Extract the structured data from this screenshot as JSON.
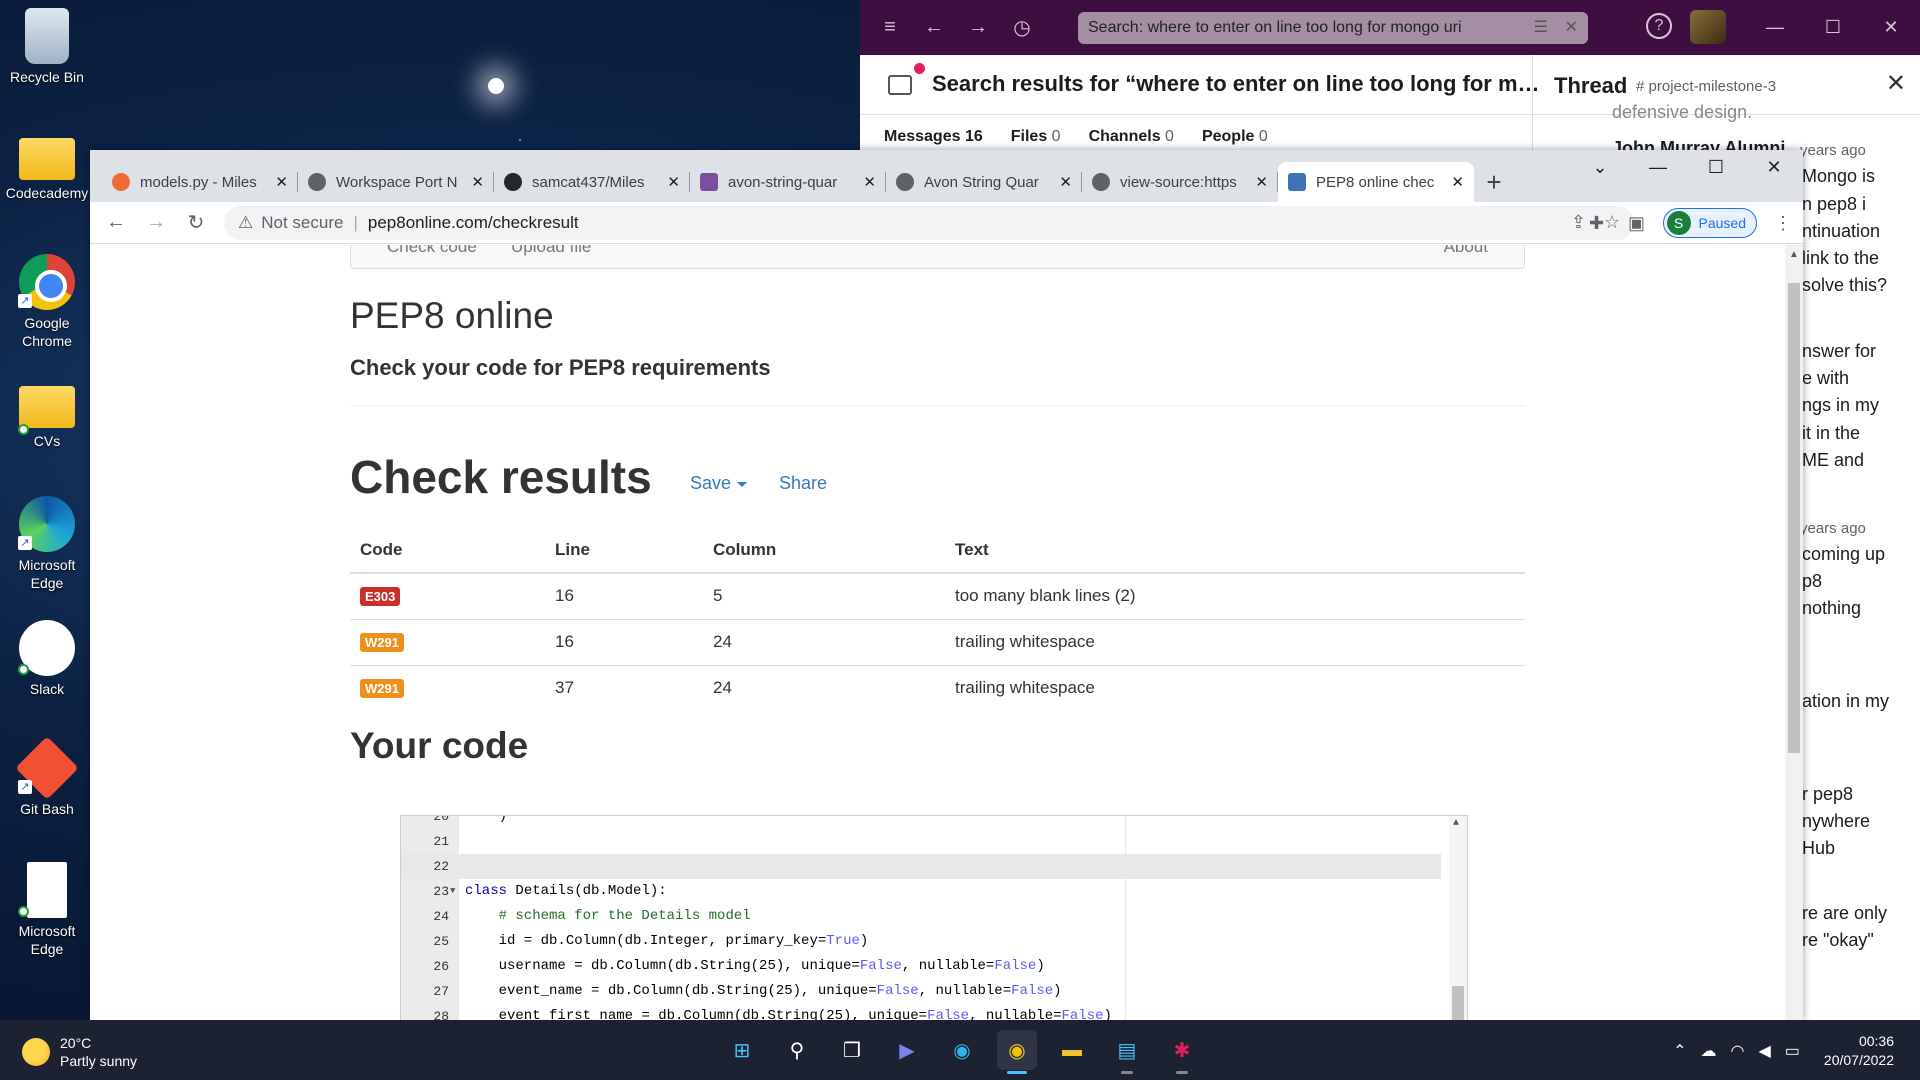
{
  "desktop": {
    "icons": [
      {
        "label": "Recycle Bin"
      },
      {
        "label": "Codecademy"
      },
      {
        "label": "Google Chrome"
      },
      {
        "label": "CVs"
      },
      {
        "label": "Microsoft Edge"
      },
      {
        "label": "Slack"
      },
      {
        "label": "Git Bash"
      },
      {
        "label": "Microsoft Edge"
      }
    ]
  },
  "slack": {
    "search_text": "Search: where to enter on line too long for mongo uri",
    "help_glyph": "?",
    "results_title": "Search results for “where to enter on line too long for m…",
    "thread_title": "Thread",
    "thread_channel": "# project-milestone-3",
    "tabs": [
      {
        "label": "Messages",
        "count": "16"
      },
      {
        "label": "Files",
        "count": "0"
      },
      {
        "label": "Channels",
        "count": "0"
      },
      {
        "label": "People",
        "count": "0"
      }
    ],
    "thread_lines": [
      "defensive design.",
      "John Murray Alumni",
      "Mongo is",
      "n pep8 i",
      "ntinuation",
      "link to the",
      "solve this?",
      "nswer for",
      "e with",
      "ngs in my",
      "it in the",
      "ME and",
      "coming up",
      "p8",
      "nothing",
      "ation in my",
      "r pep8",
      "nywhere",
      "Hub",
      "re are only",
      "re \"okay\""
    ],
    "thread_timestamps": [
      "years ago",
      "years ago"
    ]
  },
  "browser": {
    "tabs": [
      {
        "title": "models.py - Miles",
        "active": false
      },
      {
        "title": "Workspace Port N",
        "active": false
      },
      {
        "title": "samcat437/Miles",
        "active": false
      },
      {
        "title": "avon-string-quar",
        "active": false
      },
      {
        "title": "Avon String Quar",
        "active": false
      },
      {
        "title": "view-source:https",
        "active": false
      },
      {
        "title": "PEP8 online chec",
        "active": true
      }
    ],
    "security": "Not secure",
    "url": "pep8online.com/checkresult",
    "profile_initial": "S",
    "profile_status": "Paused"
  },
  "page": {
    "nav": {
      "check_code": "Check code",
      "upload_file": "Upload file",
      "about": "About"
    },
    "title": "PEP8 online",
    "subtitle": "Check your code for PEP8 requirements",
    "results_heading": "Check results",
    "save_label": "Save",
    "share_label": "Share",
    "table": {
      "headers": [
        "Code",
        "Line",
        "Column",
        "Text"
      ],
      "rows": [
        {
          "code": "E303",
          "line": "16",
          "column": "5",
          "text": "too many blank lines (2)",
          "color": "#c9302c"
        },
        {
          "code": "W291",
          "line": "16",
          "column": "24",
          "text": "trailing whitespace",
          "color": "#f0901c"
        },
        {
          "code": "W291",
          "line": "37",
          "column": "24",
          "text": "trailing whitespace",
          "color": "#f0901c"
        }
      ]
    },
    "code_heading": "Your code"
  },
  "editor": {
    "lines": [
      {
        "n": "20",
        "code": "    )"
      },
      {
        "n": "21",
        "code": ""
      },
      {
        "n": "22",
        "code": ""
      },
      {
        "n": "23",
        "code": "class Details(db.Model):"
      },
      {
        "n": "24",
        "code": "    # schema for the Details model"
      },
      {
        "n": "25",
        "code": "    id = db.Column(db.Integer, primary_key=True)"
      },
      {
        "n": "26",
        "code": "    username = db.Column(db.String(25), unique=False, nullable=False)"
      },
      {
        "n": "27",
        "code": "    event_name = db.Column(db.String(25), unique=False, nullable=False)"
      },
      {
        "n": "28",
        "code": "    event_first_name = db.Column(db.String(25), unique=False, nullable=False)"
      }
    ]
  },
  "taskbar": {
    "temperature": "20°C",
    "weather": "Partly sunny",
    "time": "00:36",
    "date": "20/07/2022"
  }
}
